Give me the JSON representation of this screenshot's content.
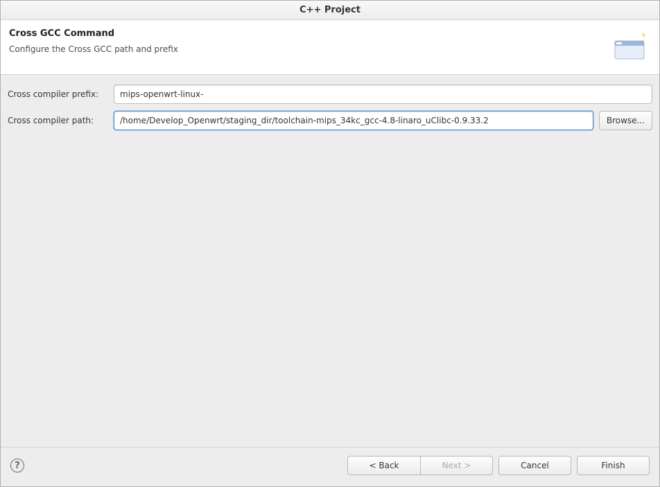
{
  "window": {
    "title": "C++ Project"
  },
  "header": {
    "title": "Cross GCC Command",
    "description": "Configure the Cross GCC path and prefix"
  },
  "form": {
    "prefix_label": "Cross compiler prefix:",
    "prefix_value": "mips-openwrt-linux-",
    "path_label": "Cross compiler path:",
    "path_value": "/home/Develop_Openwrt/staging_dir/toolchain-mips_34kc_gcc-4.8-linaro_uClibc-0.9.33.2",
    "browse_label": "Browse..."
  },
  "footer": {
    "help_symbol": "?",
    "back_label": "< Back",
    "next_label": "Next >",
    "cancel_label": "Cancel",
    "finish_label": "Finish"
  }
}
